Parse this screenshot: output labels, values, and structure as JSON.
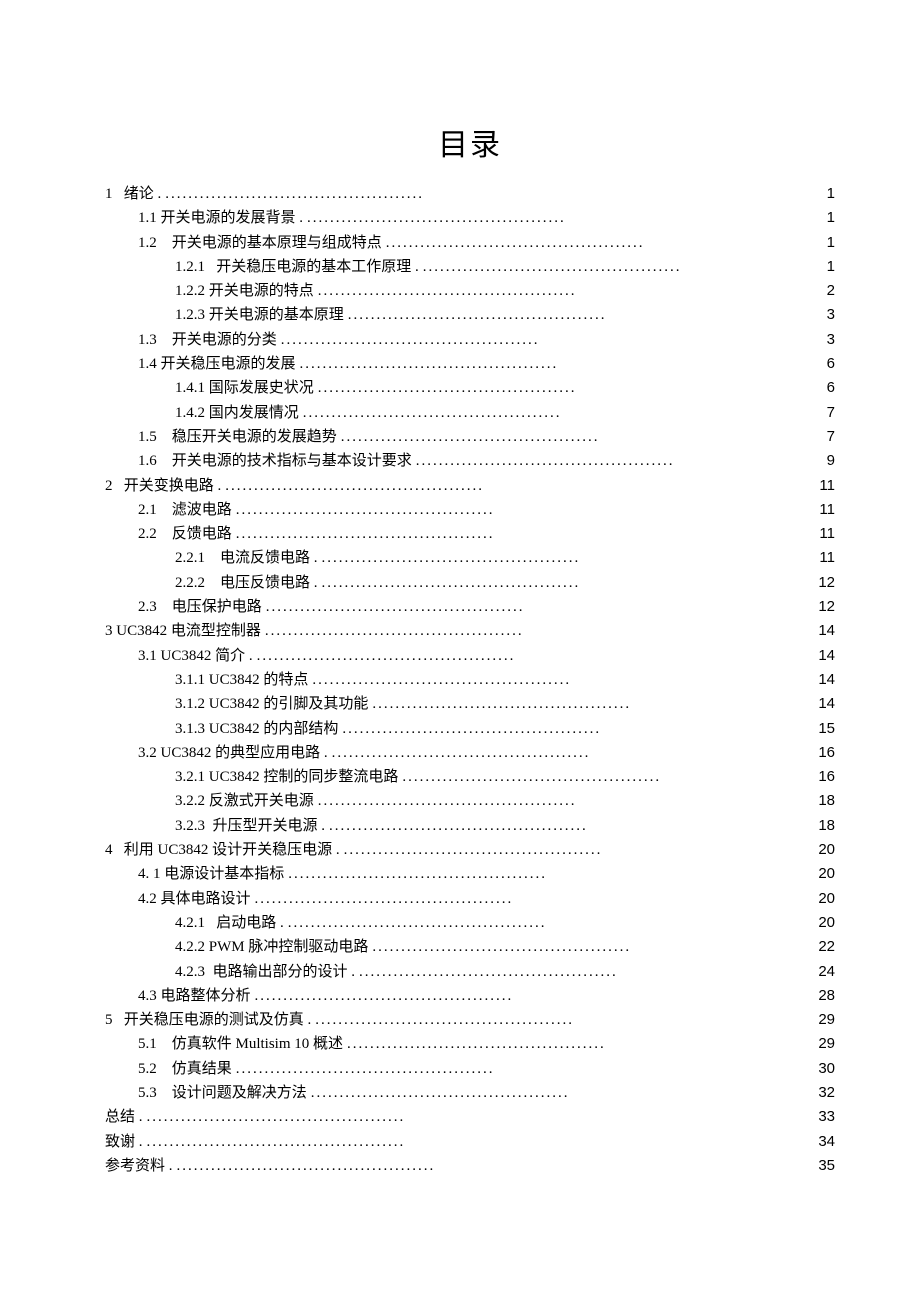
{
  "title": "目录",
  "entries": [
    {
      "indent": 0,
      "text": "1   绪论 . ",
      "page": "1"
    },
    {
      "indent": 1,
      "text": "1.1 开关电源的发展背景 . ",
      "page": "1"
    },
    {
      "indent": 1,
      "text": "1.2    开关电源的基本原理与组成特点   ",
      "page": "1"
    },
    {
      "indent": 2,
      "text": "1.2.1   开关稳压电源的基本工作原理 . ",
      "page": "1"
    },
    {
      "indent": 2,
      "text": "1.2.2  开关电源的特点   ",
      "page": "2"
    },
    {
      "indent": 2,
      "text": "1.2.3  开关电源的基本原理   ",
      "page": "3"
    },
    {
      "indent": 1,
      "text": "1.3    开关电源的分类   ",
      "page": "3"
    },
    {
      "indent": 1,
      "text": "1.4  开关稳压电源的发展   ",
      "page": "6"
    },
    {
      "indent": 2,
      "text": "1.4.1  国际发展史状况   ",
      "page": "6"
    },
    {
      "indent": 2,
      "text": "1.4.2  国内发展情况   ",
      "page": "7"
    },
    {
      "indent": 1,
      "text": "1.5    稳压开关电源的发展趋势   ",
      "page": "7"
    },
    {
      "indent": 1,
      "text": "1.6    开关电源的技术指标与基本设计要求   ",
      "page": "9"
    },
    {
      "indent": 0,
      "text": "2   开关变换电路 . ",
      "page": "11"
    },
    {
      "indent": 1,
      "text": "2.1    滤波电路   ",
      "page": "11"
    },
    {
      "indent": 1,
      "text": "2.2    反馈电路   ",
      "page": "11"
    },
    {
      "indent": 2,
      "text": "2.2.1    电流反馈电路 . ",
      "page": "11"
    },
    {
      "indent": 2,
      "text": "2.2.2    电压反馈电路 . ",
      "page": "12"
    },
    {
      "indent": 1,
      "text": "2.3    电压保护电路   ",
      "page": "12"
    },
    {
      "indent": 0,
      "text": "3 UC3842 电流型控制器   ",
      "page": "14"
    },
    {
      "indent": 1,
      "text": "3.1 UC3842 简介 . ",
      "page": "14"
    },
    {
      "indent": 2,
      "text": "3.1.1 UC3842 的特点   ",
      "page": "14"
    },
    {
      "indent": 2,
      "text": "3.1.2 UC3842 的引脚及其功能   ",
      "page": "14"
    },
    {
      "indent": 2,
      "text": "3.1.3 UC3842 的内部结构   ",
      "page": "15"
    },
    {
      "indent": 1,
      "text": "3.2  UC3842  的典型应用电路 . ",
      "page": "16"
    },
    {
      "indent": 2,
      "text": "3.2.1 UC3842 控制的同步整流电路   ",
      "page": "16"
    },
    {
      "indent": 2,
      "text": "3.2.2  反激式开关电源   ",
      "page": "18"
    },
    {
      "indent": 2,
      "text": "3.2.3  升压型开关电源 . ",
      "page": "18"
    },
    {
      "indent": 0,
      "text": "4   利用 UC3842 设计开关稳压电源 . ",
      "page": "20"
    },
    {
      "indent": 1,
      "text": "4. 1  电源设计基本指标   ",
      "page": "20"
    },
    {
      "indent": 1,
      "text": "4.2  具体电路设计   ",
      "page": "20"
    },
    {
      "indent": 2,
      "text": "4.2.1   启动电路 . ",
      "page": "20"
    },
    {
      "indent": 2,
      "text": "4.2.2 PWM 脉冲控制驱动电路   ",
      "page": "22"
    },
    {
      "indent": 2,
      "text": "4.2.3  电路输出部分的设计 . ",
      "page": "24"
    },
    {
      "indent": 1,
      "text": "4.3  电路整体分析   ",
      "page": "28"
    },
    {
      "indent": 0,
      "text": "5   开关稳压电源的测试及仿真 . ",
      "page": "29"
    },
    {
      "indent": 1,
      "text": "5.1    仿真软件 Multisim 10  概述   ",
      "page": "29"
    },
    {
      "indent": 1,
      "text": "5.2    仿真结果   ",
      "page": "30"
    },
    {
      "indent": 1,
      "text": "5.3    设计问题及解决方法   ",
      "page": "32"
    },
    {
      "indent": 0,
      "text": "总结 . ",
      "page": "33"
    },
    {
      "indent": 0,
      "text": "致谢 . ",
      "page": "34"
    },
    {
      "indent": 0,
      "text": "参考资料 . ",
      "page": "35"
    }
  ]
}
